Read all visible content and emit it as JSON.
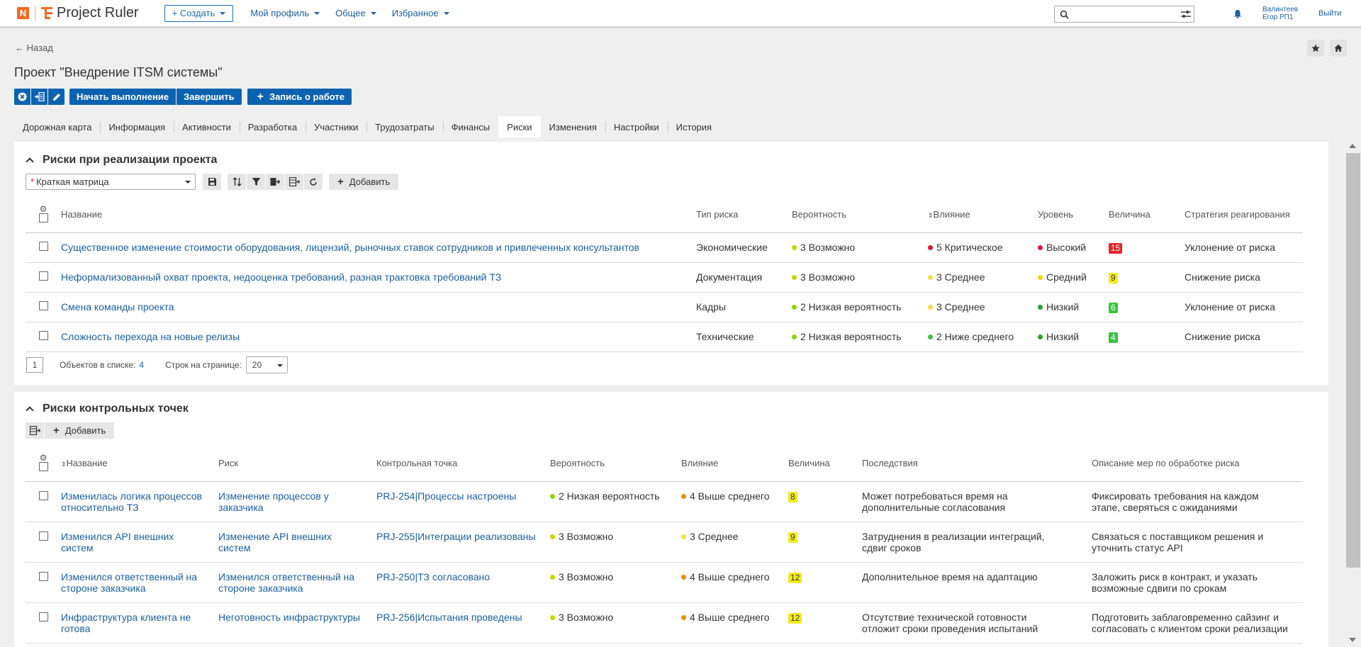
{
  "app": {
    "name": "Project Ruler",
    "logo_letter": "N"
  },
  "topbar": {
    "create_label": "+ Создать",
    "menu": [
      "Мой профиль",
      "Общее",
      "Избранное"
    ],
    "search_placeholder": "",
    "user_line1": "Валинтеев",
    "user_line2": "Егор РП1",
    "logout": "Выйти"
  },
  "page": {
    "back": "Назад",
    "title": "Проект \"Внедрение ITSM системы\"",
    "actions": {
      "start": "Начать выполнение",
      "finish": "Завершить",
      "log_work": "Запись о работе"
    },
    "tabs": [
      "Дорожная карта",
      "Информация",
      "Активности",
      "Разработка",
      "Участники",
      "Трудозатраты",
      "Финансы",
      "Риски",
      "Изменения",
      "Настройки",
      "История"
    ],
    "active_tab": "Риски"
  },
  "risks": {
    "title": "Риски при реализации проекта",
    "view_select": "Краткая матрица",
    "add_label": "Добавить",
    "columns": [
      "Название",
      "Тип риска",
      "Вероятность",
      "Влияние",
      "Уровень",
      "Величина",
      "Стратегия реагирования"
    ],
    "rows": [
      {
        "name": "Существенное изменение стоимости оборудования, лицензий, рыночных ставок сотрудников и привлеченных консультантов",
        "type": "Экономические",
        "prob": "3 Возможно",
        "prob_color": "#c6d400",
        "impact": "5 Критическое",
        "impact_color": "#e0143c",
        "level": "Высокий",
        "level_color": "#e0143c",
        "value": "15",
        "value_bg": "#e8212c",
        "value_fg": "#ffffff",
        "strategy": "Уклонение от риска"
      },
      {
        "name": "Неформализованный охват проекта, недооценка требований, разная трактовка требований ТЗ",
        "type": "Документация",
        "prob": "3 Возможно",
        "prob_color": "#c6d400",
        "impact": "3 Среднее",
        "impact_color": "#f0e040",
        "level": "Средний",
        "level_color": "#f0d800",
        "value": "9",
        "value_bg": "#f3ea1d",
        "value_fg": "#333333",
        "strategy": "Снижение риска"
      },
      {
        "name": "Смена команды проекта",
        "type": "Кадры",
        "prob": "2 Низкая вероятность",
        "prob_color": "#8fd400",
        "impact": "3 Среднее",
        "impact_color": "#f0e040",
        "level": "Низкий",
        "level_color": "#2ca02c",
        "value": "6",
        "value_bg": "#3cc43c",
        "value_fg": "#ffffff",
        "strategy": "Уклонение от риска"
      },
      {
        "name": "Сложность перехода на новые релизы",
        "type": "Технические",
        "prob": "2 Низкая вероятность",
        "prob_color": "#8fd400",
        "impact": "2 Ниже среднего",
        "impact_color": "#40c040",
        "level": "Низкий",
        "level_color": "#2ca02c",
        "value": "4",
        "value_bg": "#3cc43c",
        "value_fg": "#ffffff",
        "strategy": "Снижение риска"
      }
    ],
    "page": "1",
    "count_label": "Объектов в списке:",
    "count": "4",
    "per_page_label": "Строк на странице:",
    "per_page": "20"
  },
  "checkpoints": {
    "title": "Риски контрольных точек",
    "add_label": "Добавить",
    "columns": [
      "Название",
      "Риск",
      "Контрольная точка",
      "Вероятность",
      "Влияние",
      "Величина",
      "Последствия",
      "Описание мер по обработке риска"
    ],
    "rows": [
      {
        "name": "Изменилась логика процессов  относительно ТЗ",
        "risk": "Изменение процессов у заказчика",
        "point": "PRJ-254|Процессы настроены",
        "prob": "2 Низкая вероятность",
        "prob_color": "#8fd400",
        "impact": "4 Выше среднего",
        "impact_color": "#f08c00",
        "value": "8",
        "value_bg": "#f3ea1d",
        "consequences": "Может потребоваться время на дополнительные согласования",
        "measures": "Фиксировать требования на каждом этапе, сверяться с ожиданиями"
      },
      {
        "name": "Изменился API внешних систем",
        "risk": "Изменение API внешних систем",
        "point": "PRJ-255|Интеграции реализованы",
        "prob": "3 Возможно",
        "prob_color": "#c6d400",
        "impact": "3 Среднее",
        "impact_color": "#f0e040",
        "value": "9",
        "value_bg": "#f3ea1d",
        "consequences": "Затруднения в реализации интеграций, сдвиг сроков",
        "measures": "Связаться с поставщиком решения и уточнить статус API"
      },
      {
        "name": "Изменился ответственный на стороне заказчика",
        "risk": "Изменился ответственный на стороне заказчика",
        "point": "PRJ-250|ТЗ согласовано",
        "prob": "3 Возможно",
        "prob_color": "#c6d400",
        "impact": "4 Выше среднего",
        "impact_color": "#f08c00",
        "value": "12",
        "value_bg": "#f3ea1d",
        "consequences": "Дополнительное время на адаптацию",
        "measures": "Заложить риск в контракт, и указать возможные сдвиги по срокам"
      },
      {
        "name": "Инфраструктура клиента не готова",
        "risk": "Неготовность инфраструктуры",
        "point": "PRJ-256|Испытания проведены",
        "prob": "3 Возможно",
        "prob_color": "#c6d400",
        "impact": "4 Выше среднего",
        "impact_color": "#f08c00",
        "value": "12",
        "value_bg": "#f3ea1d",
        "consequences": "Отсутствие технической готовности отложит сроки проведения испытаний",
        "measures": "Подготовить заблаговременно сайзинг и согласовать с клиентом сроки реализации"
      }
    ]
  }
}
